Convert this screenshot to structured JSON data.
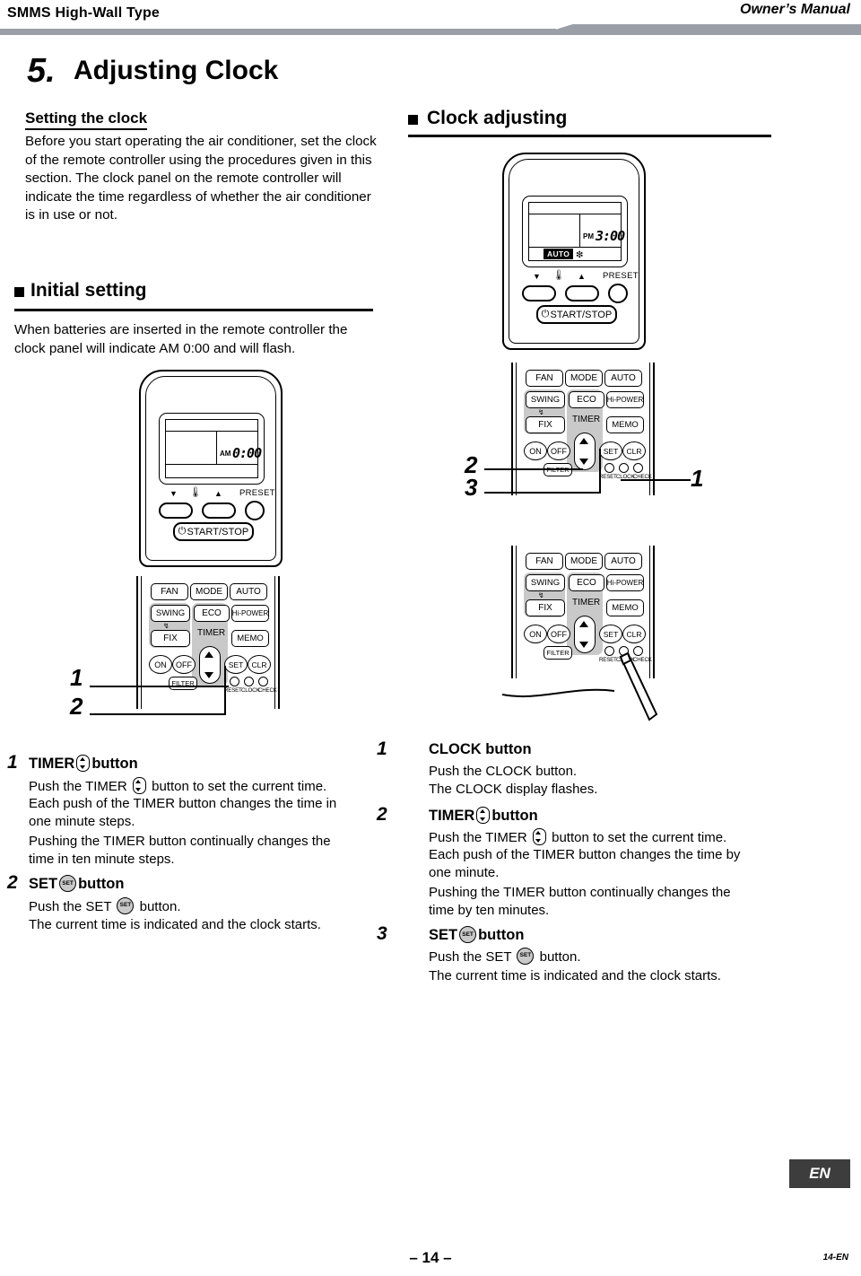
{
  "header": {
    "product": "SMMS High-Wall Type",
    "manual": "Owner’s Manual"
  },
  "section": {
    "number": "5.",
    "title": "Adjusting Clock"
  },
  "left_column": {
    "sub_heading": "Setting the clock",
    "intro": "Before you start operating the air conditioner, set the clock of the remote controller using the procedures given in this section. The clock panel on the remote controller will indicate the time regardless of whether the air conditioner is in use or not.",
    "initial_heading": "Initial setting",
    "initial_text": "When batteries are inserted in the remote controller the clock panel will indicate AM 0:00 and will flash."
  },
  "right_column": {
    "heading": "Clock adjusting"
  },
  "remote": {
    "display_top": {
      "ampm": "PM",
      "time": "3:00",
      "mode_badge": "AUTO",
      "fan_icon": "fan-icon"
    },
    "display_left": {
      "ampm": "AM",
      "time": "0:00"
    },
    "temp_down_icon": "triangle-down-icon",
    "temp_up_icon": "triangle-up-icon",
    "thermo_icon": "thermometer-icon",
    "preset_label": "PRESET",
    "start_stop": "START/STOP",
    "power_icon": "power-icon",
    "buttons_row1": [
      "FAN",
      "MODE",
      "AUTO"
    ],
    "buttons_row2": [
      "SWING",
      "ECO",
      "Hi-POWER"
    ],
    "buttons_row3": [
      "FIX",
      "MEMO"
    ],
    "timer_label": "TIMER",
    "buttons_row4": [
      "ON",
      "OFF",
      "SET",
      "CLR"
    ],
    "filter_label": "FILTER",
    "mini_labels": [
      "RESET",
      "CLOCK",
      "CHECK"
    ],
    "up_icon": "triangle-up-icon",
    "down_icon": "triangle-down-icon"
  },
  "callouts": {
    "top_right": [
      "2",
      "3",
      "1"
    ],
    "bottom_left": [
      "1",
      "2"
    ]
  },
  "steps_left": [
    {
      "num": "1",
      "head_pre": "TIMER",
      "head_icon": "timer-updown-icon",
      "head_post": "button",
      "lines": [
        "Push the TIMER   button to set the current time.",
        "Each push of the TIMER button changes the time in",
        "one minute steps.",
        "Pushing the TIMER button continually changes the",
        "time in ten minute steps."
      ]
    },
    {
      "num": "2",
      "head_pre": "SET",
      "head_icon": "set-button-icon",
      "head_post": "button",
      "lines": [
        "Push the SET   button.",
        "The current time is indicated and the clock starts."
      ]
    }
  ],
  "steps_right": [
    {
      "num": "1",
      "head_pre": "CLOCK button",
      "head_icon": "",
      "head_post": "",
      "lines": [
        "Push the CLOCK button.",
        "The CLOCK display flashes."
      ]
    },
    {
      "num": "2",
      "head_pre": "TIMER",
      "head_icon": "timer-updown-icon",
      "head_post": "button",
      "lines": [
        "Push the TIMER   button to set the current time.",
        "Each push of the TIMER button changes the time by",
        "one minute.",
        "Pushing the TIMER button continually changes the",
        "time by ten minutes."
      ]
    },
    {
      "num": "3",
      "head_pre": "SET",
      "head_icon": "set-button-icon",
      "head_post": "button",
      "lines": [
        "Push the SET   button.",
        "The current time is indicated and the clock starts."
      ]
    }
  ],
  "footer": {
    "language_badge": "EN",
    "page_number": "– 14 –",
    "page_code": "14-EN"
  },
  "colors": {
    "rule": "#9a9ea6",
    "badge_bg": "#3d3d3d",
    "pad_gray": "#c9c9c9"
  }
}
